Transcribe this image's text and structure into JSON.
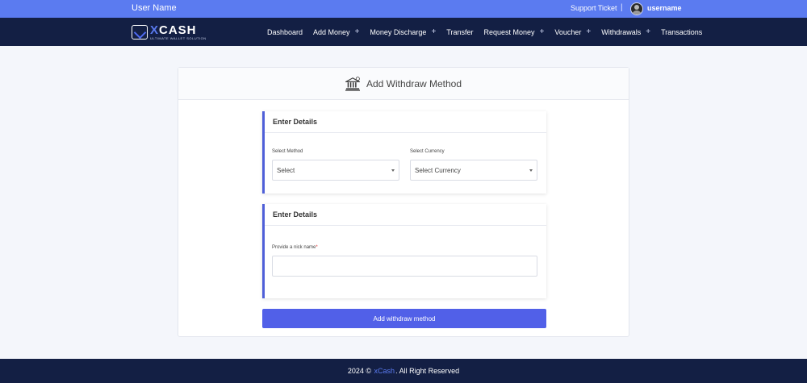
{
  "topbar": {
    "user_name": "User Name",
    "support": "Support Ticket",
    "separator": "|",
    "username": "username"
  },
  "logo": {
    "brand_x": "X",
    "brand_rest": "CASH",
    "tagline": "ULTIMATE WALLET SOLUTION"
  },
  "nav": {
    "items": [
      {
        "label": "Dashboard",
        "has_submenu": false
      },
      {
        "label": "Add Money",
        "has_submenu": true
      },
      {
        "label": "Money Discharge",
        "has_submenu": true
      },
      {
        "label": "Transfer",
        "has_submenu": false
      },
      {
        "label": "Request Money",
        "has_submenu": true
      },
      {
        "label": "Voucher",
        "has_submenu": true
      },
      {
        "label": "Withdrawals",
        "has_submenu": true
      },
      {
        "label": "Transactions",
        "has_submenu": false
      }
    ],
    "plus": "+"
  },
  "card": {
    "title": "Add Withdraw Method"
  },
  "panel1": {
    "heading": "Enter Details",
    "method_label": "Select Method",
    "method_value": "Select",
    "currency_label": "Select Currency",
    "currency_value": "Select Currency"
  },
  "panel2": {
    "heading": "Enter Details",
    "nickname_label": "Provide a nick name",
    "required_mark": "*",
    "nickname_value": ""
  },
  "submit": {
    "label": "Add withdraw method"
  },
  "footer": {
    "prefix": "2024 ©",
    "brand": "xCash",
    "suffix": ". All Right Reserved"
  },
  "colors": {
    "topbar": "#5b7bf0",
    "navbar": "#131f44",
    "accent": "#5160e8",
    "panel_border": "#4f5fd8"
  }
}
